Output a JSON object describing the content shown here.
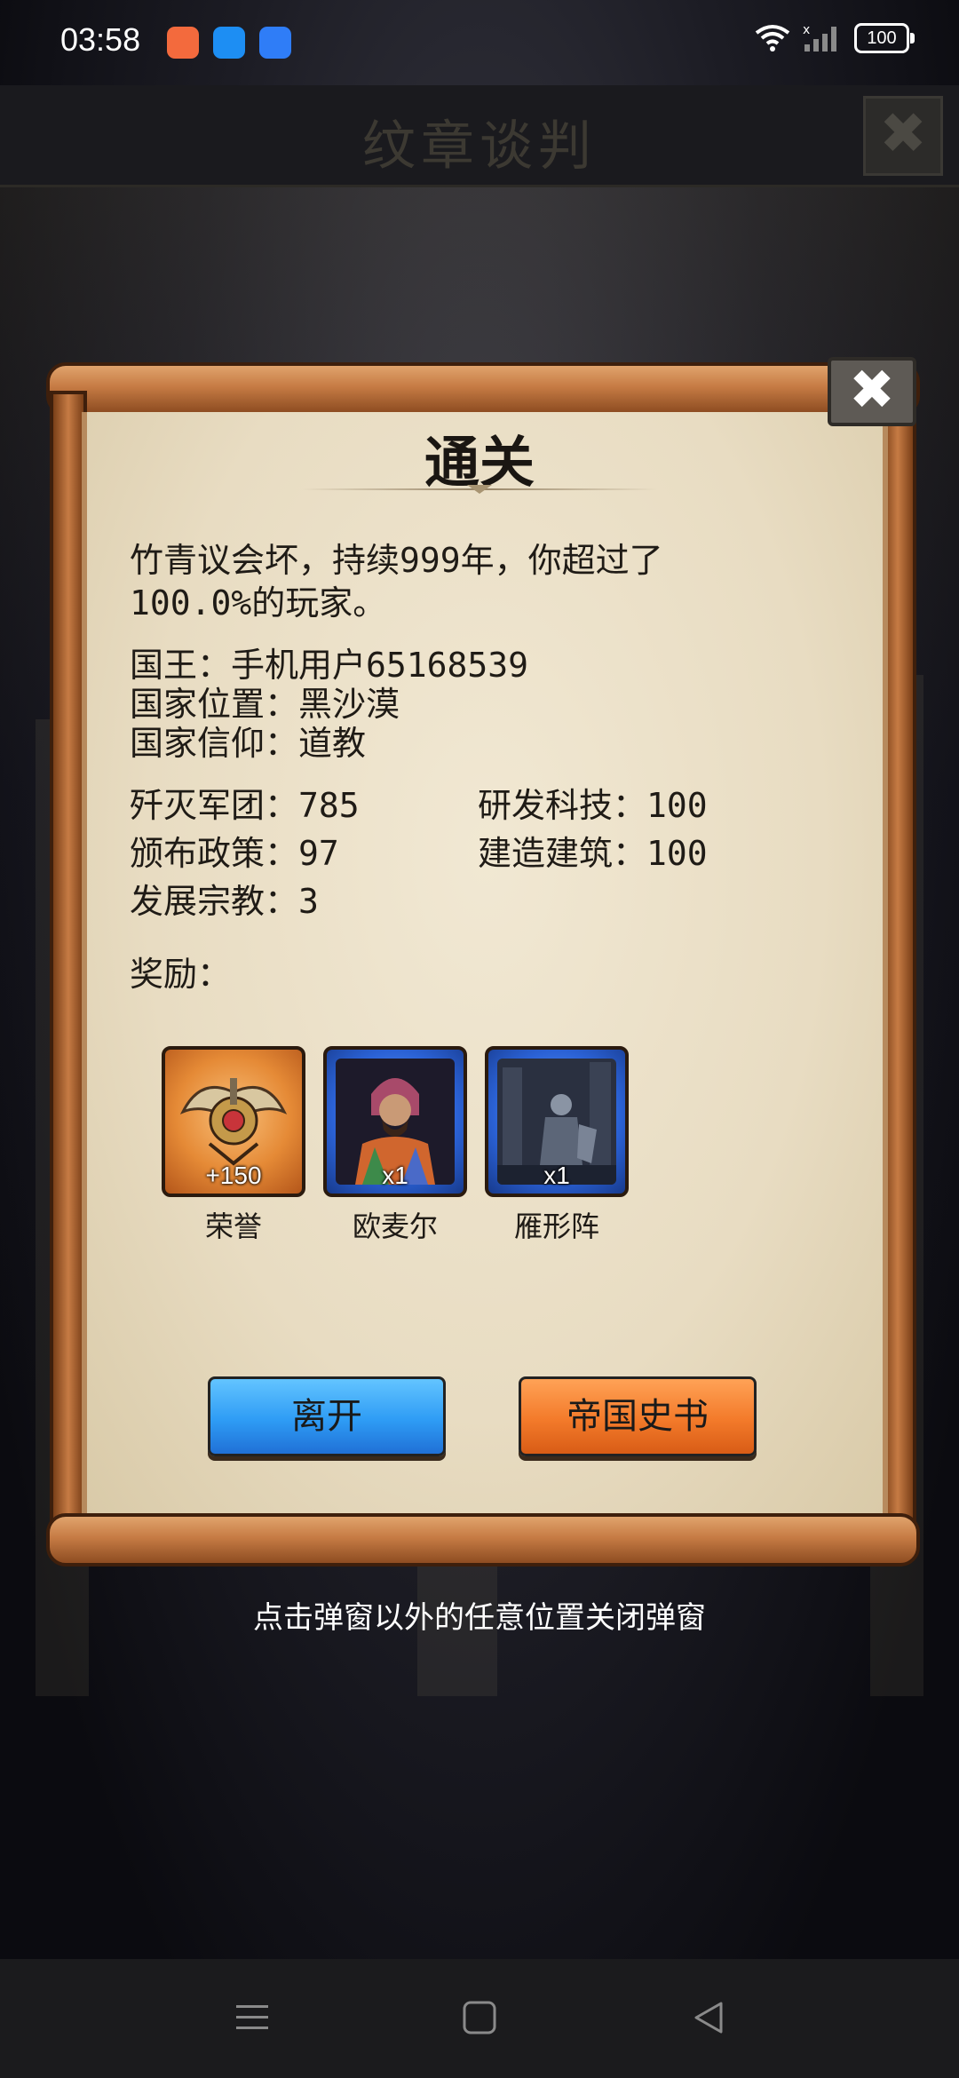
{
  "status_bar": {
    "time": "03:58",
    "battery": "100",
    "app_icon_colors": [
      "#f36a3d",
      "#1d8ef3",
      "#2f7df7"
    ]
  },
  "game_header": {
    "title": "纹章谈判"
  },
  "dialog": {
    "title": "通关",
    "summary_line1": "竹青议会坏，持续999年，你超过了",
    "summary_line2": "100.0%的玩家。",
    "king": "国王：手机用户65168539",
    "location": "国家位置：黑沙漠",
    "religion": "国家信仰：道教",
    "stats": {
      "legions_destroyed": "歼灭军团：785",
      "tech_researched": "研发科技：100",
      "policies": "颁布政策：97",
      "buildings": "建造建筑：100",
      "religions": "发展宗教：3"
    },
    "rewards_label": "奖励：",
    "rewards": [
      {
        "name": "荣誉",
        "amount": "+150",
        "frame": "orange"
      },
      {
        "name": "欧麦尔",
        "amount": "x1",
        "frame": "blue"
      },
      {
        "name": "雁形阵",
        "amount": "x1",
        "frame": "blue"
      }
    ],
    "buttons": {
      "leave": "离开",
      "history": "帝国史书"
    }
  },
  "hint": "点击弹窗以外的任意位置关闭弹窗",
  "colors": {
    "parchment": "#eee4cc",
    "scroll_wood": "#c67b44",
    "leave_button": "#2e9cf5",
    "history_button": "#f37a2a"
  }
}
